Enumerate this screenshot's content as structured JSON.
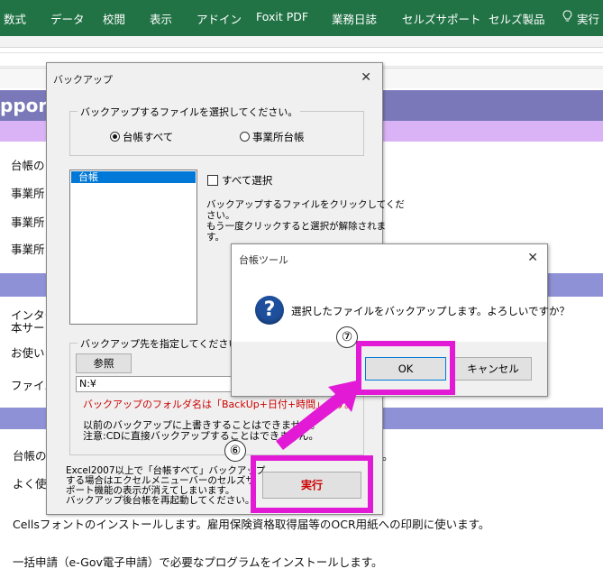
{
  "ribbon": {
    "tabs": [
      {
        "label": "数式"
      },
      {
        "label": "データ"
      },
      {
        "label": "校閲"
      },
      {
        "label": "表示"
      },
      {
        "label": "アドイン"
      },
      {
        "label": "Foxit PDF"
      },
      {
        "label": "業務日誌"
      },
      {
        "label": "セルズサポート"
      },
      {
        "label": "セルズ製品"
      }
    ],
    "tell_me": "実行"
  },
  "sheet": {
    "band_title": "pport",
    "lines": [
      "台帳の",
      "事業所",
      "事業所",
      "事業所",
      "インター",
      "本サー",
      "お使い",
      "ファイル",
      "台帳の",
      "よく使う",
      "Cellsフォントのインストールします。雇用保険資格取得届等のOCR用紙への印刷に使います。",
      "一括申請（e-Gov電子申請）で必要なプログラムをインストールします。"
    ],
    "row_tail": "。"
  },
  "backup_dialog": {
    "title": "バックアップ",
    "close": "✕",
    "select_group_label": "バックアップするファイルを選択してください。",
    "radio_all": "台帳すべて",
    "radio_office": "事業所台帳",
    "list_item": "台帳",
    "select_all": "すべて選択",
    "help_line1": "バックアップするファイルをクリックしてくだ",
    "help_line2": "さい。",
    "help_line3": "もう一度クリックすると選択が解除されま",
    "help_line4": "す。",
    "dest_group_label": "バックアップ先を指定してください。",
    "browse_button": "参照",
    "path_value": "N:¥",
    "folder_note": "バックアップのフォルダ名は「BackUp+日付+時間」です。",
    "note1": "以前のバックアップに上書きすることはできません。",
    "note2": "注意:CDに直接バックアップすることはできません。",
    "excel_note1": "Excel2007以上で「台帳すべて」バックアップ",
    "excel_note2": "する場合はエクセルメニューバーのセルズサ",
    "excel_note3": "ポート機能の表示が消えてしまいます。",
    "excel_note4": "バックアップ後台帳を再起動してください。",
    "execute_button": "実行",
    "colors": {
      "folder_note": "#cc0000",
      "execute": "#cc0000"
    }
  },
  "message_box": {
    "title": "台帳ツール",
    "close": "✕",
    "icon": "question-icon",
    "message": "選択したファイルをバックアップします。よろしいですか？",
    "ok_button": "OK",
    "cancel_button": "キャンセル"
  },
  "annotations": {
    "step6": "⑥",
    "step7": "⑦",
    "highlight_color": "#e21ad6"
  }
}
